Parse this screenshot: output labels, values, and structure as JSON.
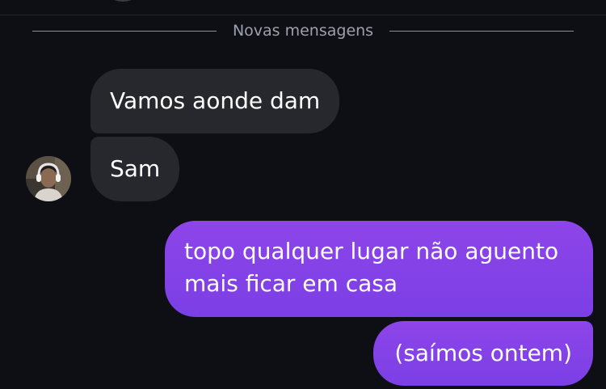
{
  "separator": {
    "label": "Novas mensagens"
  },
  "messages": [
    {
      "text": "Vamos aonde dam",
      "direction": "incoming"
    },
    {
      "text": "Sam",
      "direction": "incoming"
    },
    {
      "text": "topo qualquer lugar não aguento mais ficar em casa",
      "direction": "outgoing"
    },
    {
      "text": "(saímos ontem)",
      "direction": "outgoing"
    }
  ],
  "colors": {
    "background": "#0d0f14",
    "incoming_bubble": "#26282e",
    "outgoing_bubble": "#8540e7",
    "separator_text": "#9ca1ab"
  },
  "icons": {
    "sender_avatar": "avatar-person-with-headphones"
  }
}
